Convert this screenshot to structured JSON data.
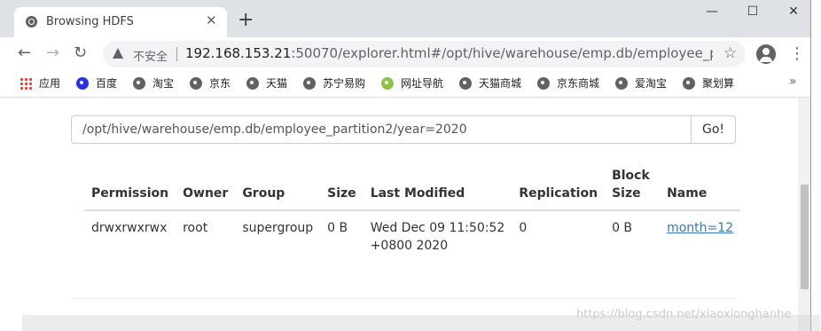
{
  "browser": {
    "tab_title": "Browsing HDFS",
    "insecure_label": "不安全",
    "url_host": "192.168.153.21",
    "url_rest": ":50070/explorer.html#/opt/hive/warehouse/emp.db/employee_partitio..."
  },
  "bookmarks": [
    {
      "label": "应用",
      "icon": "apps-icon"
    },
    {
      "label": "百度",
      "icon": "baidu-icon"
    },
    {
      "label": "淘宝",
      "icon": "globe-icon"
    },
    {
      "label": "京东",
      "icon": "globe-icon"
    },
    {
      "label": "天猫",
      "icon": "globe-icon"
    },
    {
      "label": "苏宁易购",
      "icon": "globe-icon"
    },
    {
      "label": "网址导航",
      "icon": "hao-icon"
    },
    {
      "label": "天猫商城",
      "icon": "globe-icon"
    },
    {
      "label": "京东商城",
      "icon": "globe-icon"
    },
    {
      "label": "爱淘宝",
      "icon": "globe-icon"
    },
    {
      "label": "聚划算",
      "icon": "globe-icon"
    }
  ],
  "explorer": {
    "path_value": "/opt/hive/warehouse/emp.db/employee_partition2/year=2020",
    "go_label": "Go!",
    "columns": [
      "Permission",
      "Owner",
      "Group",
      "Size",
      "Last Modified",
      "Replication",
      "Block Size",
      "Name"
    ],
    "rows": [
      {
        "permission": "drwxrwxrwx",
        "owner": "root",
        "group": "supergroup",
        "size": "0 B",
        "last_modified_1": "Wed Dec 09 11:50:52",
        "last_modified_2": "+0800 2020",
        "replication": "0",
        "block_size": "0 B",
        "name": "month=12"
      }
    ]
  },
  "watermark": "https://blog.csdn.net/xiaoxionghanhe",
  "colors": {
    "link": "#337ab7",
    "titlebar": "#dee1e6"
  }
}
